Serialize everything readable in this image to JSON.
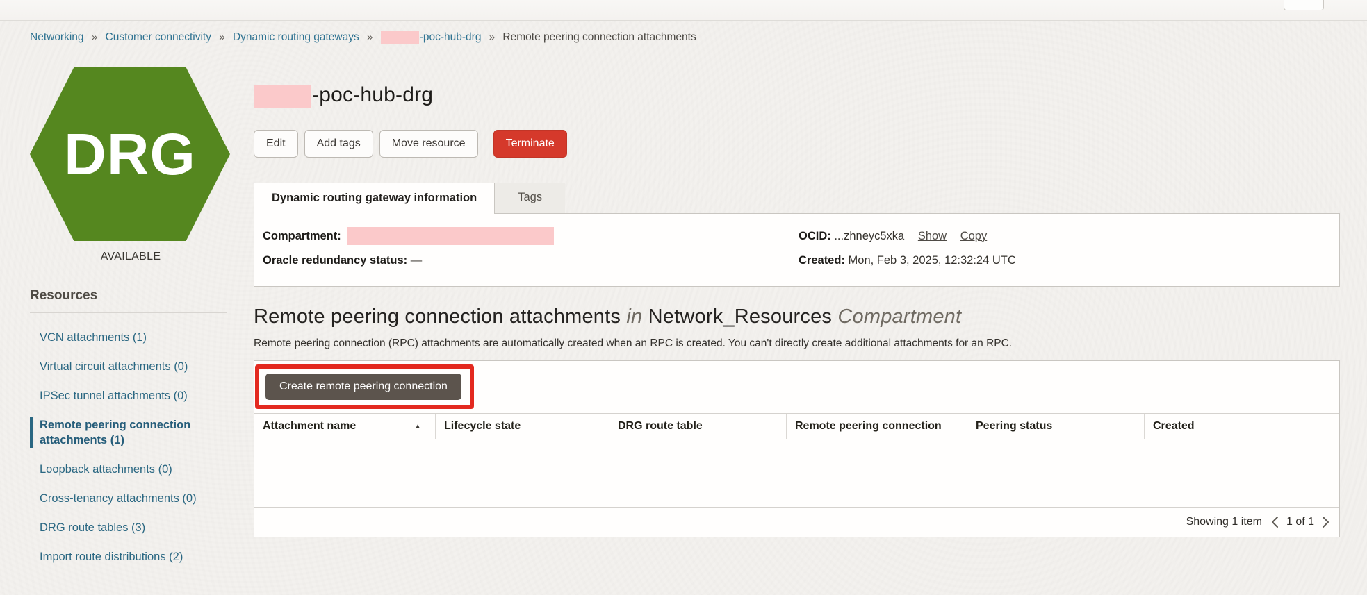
{
  "colors": {
    "link_blue": "#2e7291",
    "drg_green": "#55871f",
    "terminate_red": "#d5392b",
    "annotation_red": "#e3291f",
    "redaction_pink": "#fbc9ca",
    "create_button_gray": "#5c544d"
  },
  "breadcrumb": {
    "separator": "»",
    "items": [
      {
        "label": "Networking"
      },
      {
        "label": "Customer connectivity"
      },
      {
        "label": "Dynamic routing gateways"
      },
      {
        "label": "-poc-hub-drg",
        "redacted_prefix": true
      },
      {
        "label": "Remote peering connection attachments",
        "current": true
      }
    ]
  },
  "resource_icon": {
    "label": "DRG",
    "status": "AVAILABLE"
  },
  "header": {
    "title": "-poc-hub-drg",
    "actions": {
      "edit": "Edit",
      "add_tags": "Add tags",
      "move_resource": "Move resource",
      "terminate": "Terminate"
    }
  },
  "tabs": {
    "info": "Dynamic routing gateway information",
    "tags": "Tags"
  },
  "details": {
    "compartment_label": "Compartment:",
    "redundancy_label": "Oracle redundancy status:",
    "redundancy_value": "—",
    "ocid_label": "OCID:",
    "ocid_value": "...zhneyc5xka",
    "show_link": "Show",
    "copy_link": "Copy",
    "created_label": "Created:",
    "created_value": "Mon, Feb 3, 2025, 12:32:24 UTC"
  },
  "sidebar": {
    "heading": "Resources",
    "items": [
      {
        "label": "VCN attachments (1)"
      },
      {
        "label": "Virtual circuit attachments (0)"
      },
      {
        "label": "IPSec tunnel attachments (0)"
      },
      {
        "label": "Remote peering connection attachments (1)",
        "selected": true
      },
      {
        "label": "Loopback attachments (0)"
      },
      {
        "label": "Cross-tenancy attachments (0)"
      },
      {
        "label": "DRG route tables (3)"
      },
      {
        "label": "Import route distributions (2)"
      }
    ]
  },
  "section": {
    "title_main": "Remote peering connection attachments",
    "title_in": "in",
    "title_compartment_name": "Network_Resources",
    "title_compartment_word": "Compartment",
    "description": "Remote peering connection (RPC) attachments are automatically created when an RPC is created. You can't directly create additional attachments for an RPC."
  },
  "table": {
    "create_button": "Create remote peering connection",
    "columns": [
      {
        "label": "Attachment name",
        "sorted": "asc"
      },
      {
        "label": "Lifecycle state"
      },
      {
        "label": "DRG route table"
      },
      {
        "label": "Remote peering connection"
      },
      {
        "label": "Peering status"
      },
      {
        "label": "Created"
      }
    ],
    "rows": [],
    "pagination": {
      "showing": "Showing 1 item",
      "page": "1 of 1"
    }
  }
}
